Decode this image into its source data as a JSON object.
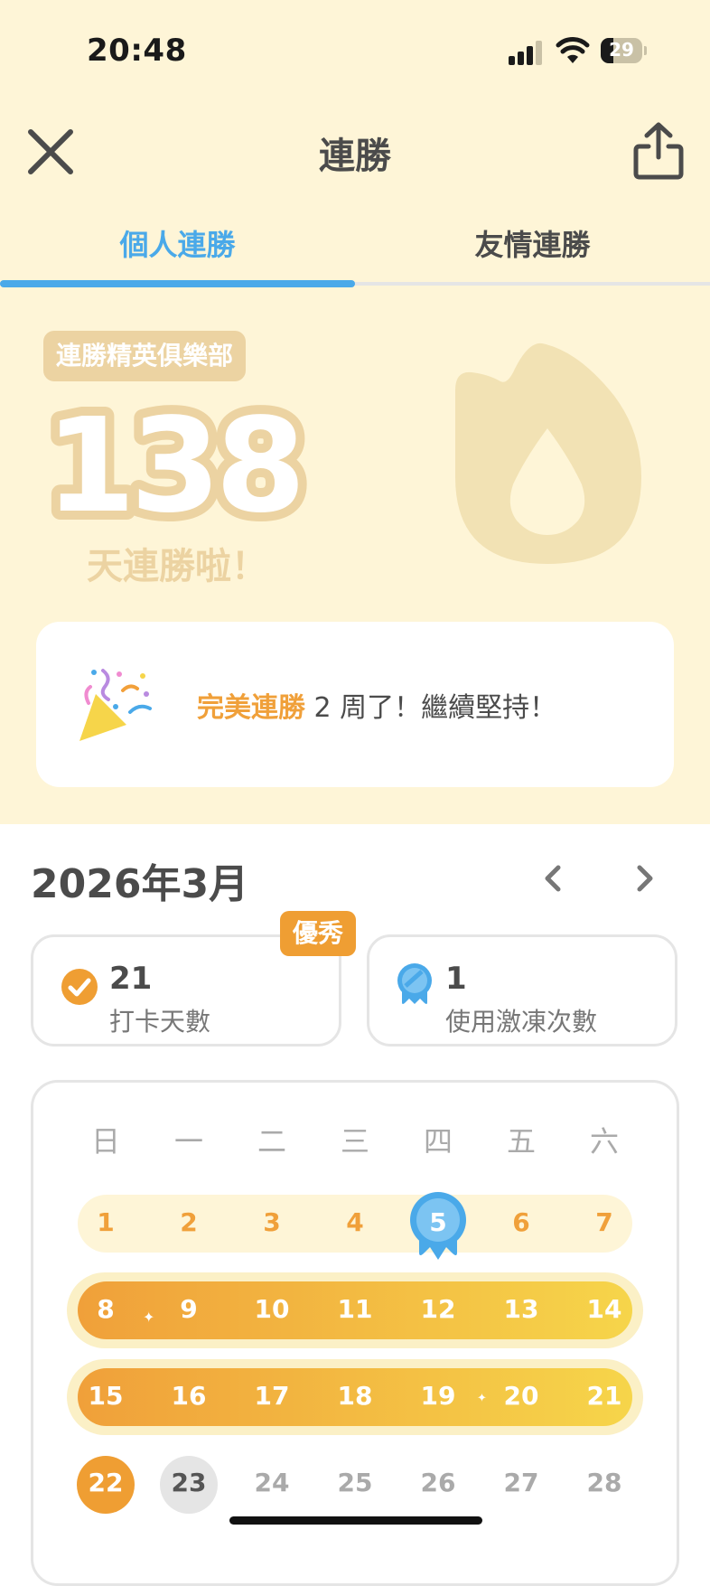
{
  "status_bar": {
    "time": "20:48",
    "battery": "29"
  },
  "header": {
    "title": "連勝"
  },
  "tabs": [
    {
      "label": "個人連勝",
      "active": true
    },
    {
      "label": "友情連勝",
      "active": false
    }
  ],
  "streak": {
    "club_badge": "連勝精英俱樂部",
    "count": "138",
    "subtitle": "天連勝啦！"
  },
  "milestone": {
    "highlight": "完美連勝",
    "rest": " 2 周了！繼續堅持！"
  },
  "calendar": {
    "month": "2026年3月",
    "stats": {
      "checkin": {
        "value": "21",
        "label": "打卡天數",
        "badge": "優秀"
      },
      "freeze": {
        "value": "1",
        "label": "使用激凍次數"
      }
    },
    "weekdays": [
      "日",
      "一",
      "二",
      "三",
      "四",
      "五",
      "六"
    ],
    "weeks": [
      [
        "1",
        "2",
        "3",
        "4",
        "5",
        "6",
        "7"
      ],
      [
        "8",
        "9",
        "10",
        "11",
        "12",
        "13",
        "14"
      ],
      [
        "15",
        "16",
        "17",
        "18",
        "19",
        "20",
        "21"
      ],
      [
        "22",
        "23",
        "24",
        "25",
        "26",
        "27",
        "28"
      ]
    ]
  },
  "colors": {
    "accent_blue": "#4aa9e9",
    "accent_orange": "#f0a03a",
    "streak_bg": "#fef5d7"
  }
}
